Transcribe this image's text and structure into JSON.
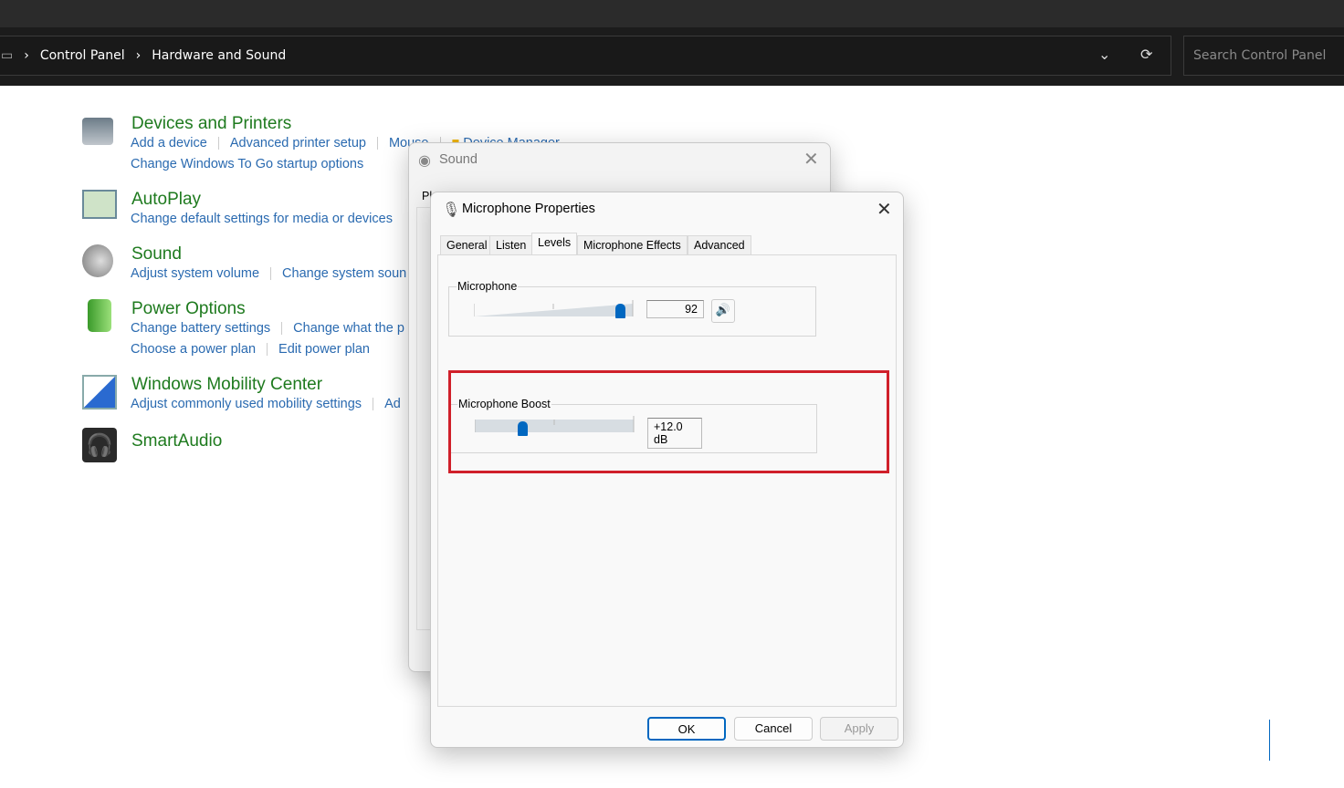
{
  "explorer": {
    "breadcrumb": [
      "Control Panel",
      "Hardware and Sound"
    ],
    "search_placeholder": "Search Control Panel"
  },
  "categories": [
    {
      "title": "Devices and Printers",
      "links": [
        [
          "Add a device",
          "Advanced printer setup",
          "Mouse",
          "Device Manager"
        ],
        [
          "Change Windows To Go startup options"
        ]
      ]
    },
    {
      "title": "AutoPlay",
      "links": [
        [
          "Change default settings for media or devices"
        ]
      ]
    },
    {
      "title": "Sound",
      "links": [
        [
          "Adjust system volume",
          "Change system soun"
        ]
      ]
    },
    {
      "title": "Power Options",
      "links": [
        [
          "Change battery settings",
          "Change what the p"
        ],
        [
          "Choose a power plan",
          "Edit power plan"
        ]
      ]
    },
    {
      "title": "Windows Mobility Center",
      "links": [
        [
          "Adjust commonly used mobility settings",
          "Ad"
        ]
      ]
    },
    {
      "title": "SmartAudio",
      "links": []
    }
  ],
  "sound_dialog": {
    "title": "Sound",
    "tab_partial": "Pl"
  },
  "mic_dialog": {
    "title": "Microphone Properties",
    "tabs": [
      "General",
      "Listen",
      "Levels",
      "Microphone Effects",
      "Advanced"
    ],
    "active_tab": "Levels",
    "microphone": {
      "label": "Microphone",
      "value": "92",
      "level_percent": 92
    },
    "boost": {
      "label": "Microphone Boost",
      "value": "+12.0 dB",
      "level_fraction": 0.3
    },
    "buttons": {
      "ok": "OK",
      "cancel": "Cancel",
      "apply": "Apply"
    },
    "highlight_color": "#d0202a"
  }
}
